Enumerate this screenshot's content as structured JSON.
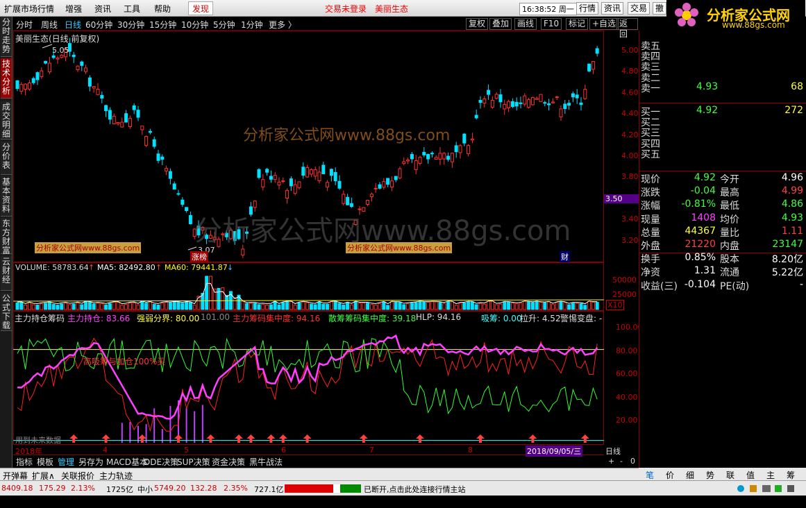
{
  "menubar": {
    "items": [
      "扩展市场行情",
      "增强",
      "资讯",
      "工具",
      "帮助"
    ],
    "active": "发现",
    "center_left": "交易未登录",
    "center_right": "美丽生态",
    "clock": "16:38:52 周一",
    "right_buttons": [
      "行情",
      "资讯",
      "交易",
      "撤"
    ]
  },
  "logo": {
    "title": "分析家公式网",
    "url": "www.88gs.com"
  },
  "left_tabs": [
    "分时走势",
    "技术分析",
    "成交明细",
    "分价表",
    "基本资料",
    "东方财富",
    "云财经",
    "公式下载"
  ],
  "left_tab_active": 1,
  "periods": [
    "分时",
    "周线",
    "日线",
    "60分钟",
    "30分钟",
    "15分钟",
    "10分钟",
    "5分钟",
    "1分钟",
    "更多 〉"
  ],
  "period_active": 2,
  "toolbar": [
    "复权",
    "叠加",
    "画线",
    "F10",
    "标记",
    "+自选",
    "返回"
  ],
  "price_chart": {
    "title": "美丽生态(日线 前复权)",
    "high_label": "5.05",
    "low_label": "3.07",
    "badge_zt": "涨榜",
    "badge_cai": "财",
    "watermark": "分析家公式网www.88gs.com",
    "small_wm": "分析家公式网www.88gs.com",
    "y_ticks": [
      "5.00",
      "4.80",
      "4.60",
      "4.40",
      "4.20",
      "4.00",
      "3.80",
      "3.60",
      "3.40",
      "3.20"
    ],
    "price_tag": "3.50"
  },
  "volume": {
    "label_vol": "VOLUME: 58783.64",
    "label_ma5": "MA5: 82492.80",
    "label_ma60": "MA60: 79441.87",
    "y_ticks": [
      "50000",
      "25000"
    ],
    "x10": "X10"
  },
  "indicator": {
    "name": "主力持仓筹码",
    "items": [
      {
        "text": "主力持仓: 83.66",
        "color": "#ff40ff"
      },
      {
        "text": "强弱分界: 80.00",
        "color": "#ffff40"
      },
      {
        "text": "101.00",
        "color": "#888"
      },
      {
        "text": "主力筹码集中度: 94.16",
        "color": "#ff3030"
      },
      {
        "text": "散筹筹码集中度: 39.18",
        "color": "#40ff40"
      },
      {
        "text": "HLP: 94.16",
        "color": "#ddd"
      },
      {
        "text": "吸筹: 0.00",
        "color": "#40ffff"
      },
      {
        "text": "拉升: 4.52",
        "color": "#ddd"
      },
      {
        "text": "警惕变盘: -",
        "color": "#ddd"
      }
    ],
    "y_ticks": [
      "100.00",
      "80.00",
      "60.00",
      "40.00",
      "20.00"
    ],
    "signal_text": "高吸筹与加仓100%买",
    "future_note": "用到未来数据"
  },
  "xaxis": {
    "labels": [
      "2018年",
      "4",
      "5",
      "6",
      "7",
      "8"
    ],
    "cursor_date": "2018/09/05/三",
    "period": "日线",
    "controls": [
      "+",
      "-",
      "0"
    ]
  },
  "bottom_tabs": [
    "指标",
    "模板",
    "管理",
    "另存为",
    "MACD基本",
    "DDE决策",
    "SUP决策",
    "资金决策",
    "黑牛战法"
  ],
  "bottom_tab_active": 2,
  "bar3": [
    "开弹幕",
    "扩展∧",
    "关联报价",
    "主力轨迹"
  ],
  "right_tabs": [
    "笔",
    "价",
    "细",
    "势",
    "联",
    "值",
    "主",
    "筹"
  ],
  "orderbook": {
    "sells": [
      {
        "label": "卖五",
        "price": "",
        "vol": ""
      },
      {
        "label": "卖四",
        "price": "",
        "vol": ""
      },
      {
        "label": "卖三",
        "price": "",
        "vol": ""
      },
      {
        "label": "卖二",
        "price": "",
        "vol": ""
      },
      {
        "label": "卖一",
        "price": "4.93",
        "vol": "68"
      }
    ],
    "buys": [
      {
        "label": "买一",
        "price": "4.92",
        "vol": "272"
      },
      {
        "label": "买二",
        "price": "",
        "vol": ""
      },
      {
        "label": "买三",
        "price": "",
        "vol": ""
      },
      {
        "label": "买四",
        "price": "",
        "vol": ""
      },
      {
        "label": "买五",
        "price": "",
        "vol": ""
      }
    ]
  },
  "quote": [
    {
      "l1": "现价",
      "v1": "4.92",
      "c1": "#40ff40",
      "l2": "今开",
      "v2": "4.96",
      "c2": "#fff"
    },
    {
      "l1": "涨跌",
      "v1": "-0.04",
      "c1": "#40ff40",
      "l2": "最高",
      "v2": "4.99",
      "c2": "#ff4040"
    },
    {
      "l1": "涨幅",
      "v1": "-0.81%",
      "c1": "#40ff40",
      "l2": "最低",
      "v2": "4.86",
      "c2": "#40ff40"
    },
    {
      "l1": "现量",
      "v1": "1408",
      "c1": "#ff40ff",
      "l2": "均价",
      "v2": "4.93",
      "c2": "#40ff40"
    },
    {
      "l1": "总量",
      "v1": "44367",
      "c1": "#ffff40",
      "l2": "量比",
      "v2": "1.11",
      "c2": "#ff4040"
    },
    {
      "l1": "外盘",
      "v1": "21220",
      "c1": "#ff4040",
      "l2": "内盘",
      "v2": "23147",
      "c2": "#40ff40"
    },
    {
      "l1": "换手",
      "v1": "0.85%",
      "c1": "#fff",
      "l2": "股本",
      "v2": "8.20亿",
      "c2": "#fff"
    },
    {
      "l1": "净资",
      "v1": "1.31",
      "c1": "#fff",
      "l2": "流通",
      "v2": "5.22亿",
      "c2": "#fff"
    },
    {
      "l1": "收益(三)",
      "v1": "-0.104",
      "c1": "#fff",
      "l2": "PE(动)",
      "v2": "-",
      "c2": "#fff"
    }
  ],
  "status": {
    "idx1": "8409.18",
    "idx1_chg": "175.29",
    "idx1_pct": "2.13%",
    "amt1": "1725亿",
    "idx2_name": "中小",
    "idx2": "5749.20",
    "idx2_chg": "132.28",
    "idx2_pct": "2.35%",
    "amt2": "727.1亿",
    "msg": "已断开,点击此处连接行情主站"
  },
  "colors": {
    "up": "#ff3030",
    "down": "#00ffff",
    "frame": "#800000",
    "accent": "#3cf"
  }
}
